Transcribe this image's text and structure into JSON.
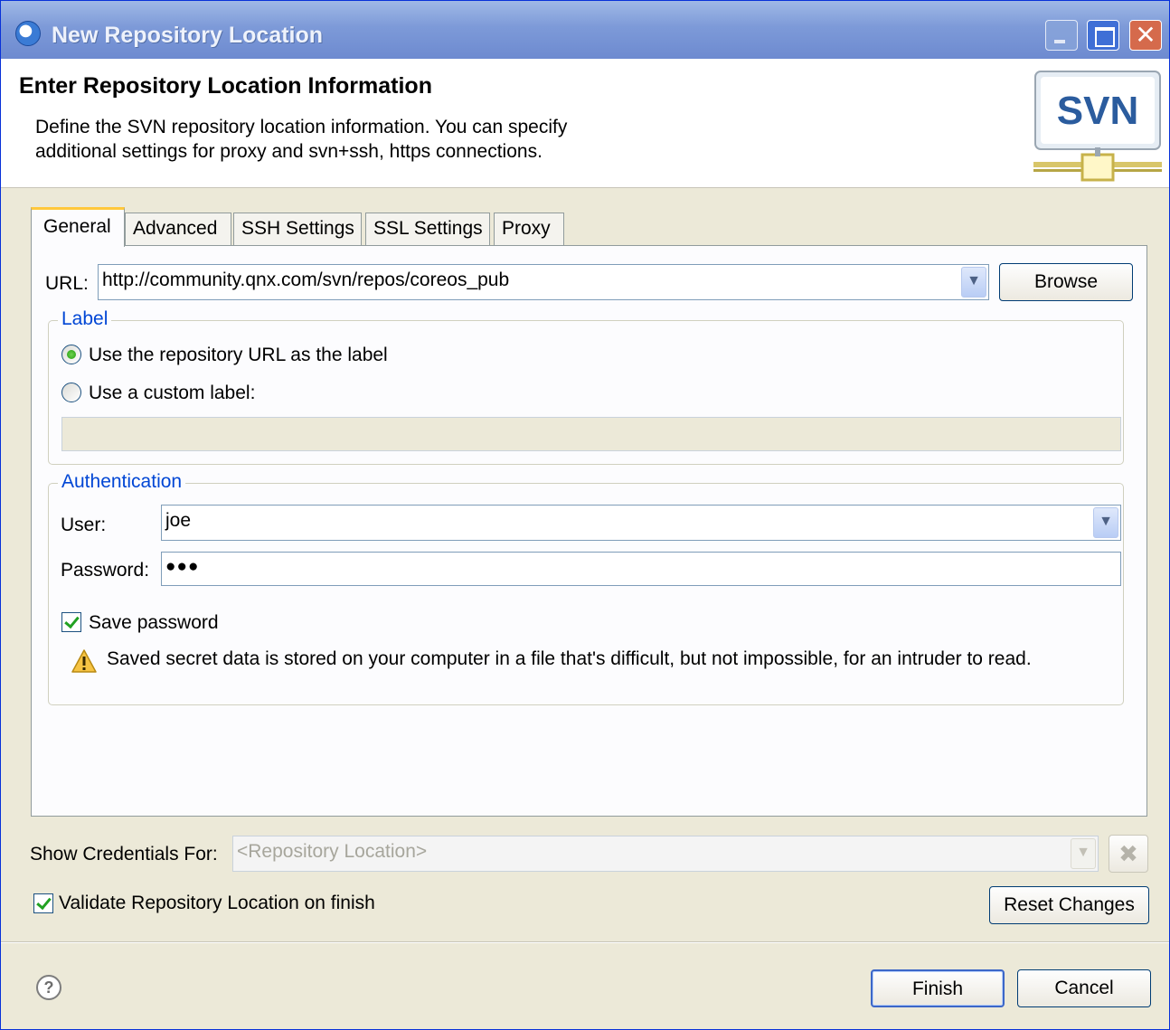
{
  "window": {
    "title": "New Repository Location"
  },
  "banner": {
    "heading": "Enter Repository Location Information",
    "description": "Define the SVN repository location information. You can specify additional settings for proxy and svn+ssh, https connections.",
    "logo_text": "SVN"
  },
  "tabs": [
    "General",
    "Advanced",
    "SSH Settings",
    "SSL Settings",
    "Proxy"
  ],
  "general": {
    "url_label": "URL:",
    "url_value": "http://community.qnx.com/svn/repos/coreos_pub",
    "browse_label": "Browse",
    "label_group": {
      "title": "Label",
      "option_url": "Use the repository URL as the label",
      "option_custom": "Use a custom label:",
      "custom_value": ""
    },
    "auth_group": {
      "title": "Authentication",
      "user_label": "User:",
      "user_value": "joe",
      "password_label": "Password:",
      "password_value": "●●●",
      "save_password_label": "Save password",
      "warning_text": "Saved secret data is stored on your computer in a file that's difficult, but not impossible, for an intruder to read."
    }
  },
  "bottom": {
    "show_credentials_label": "Show Credentials For:",
    "credentials_placeholder": "<Repository Location>",
    "validate_label": "Validate Repository Location on finish",
    "reset_label": "Reset Changes"
  },
  "footer": {
    "finish_label": "Finish",
    "cancel_label": "Cancel"
  },
  "icons": {
    "help": "help-icon",
    "warning": "warning-icon",
    "delete": "delete-icon"
  }
}
